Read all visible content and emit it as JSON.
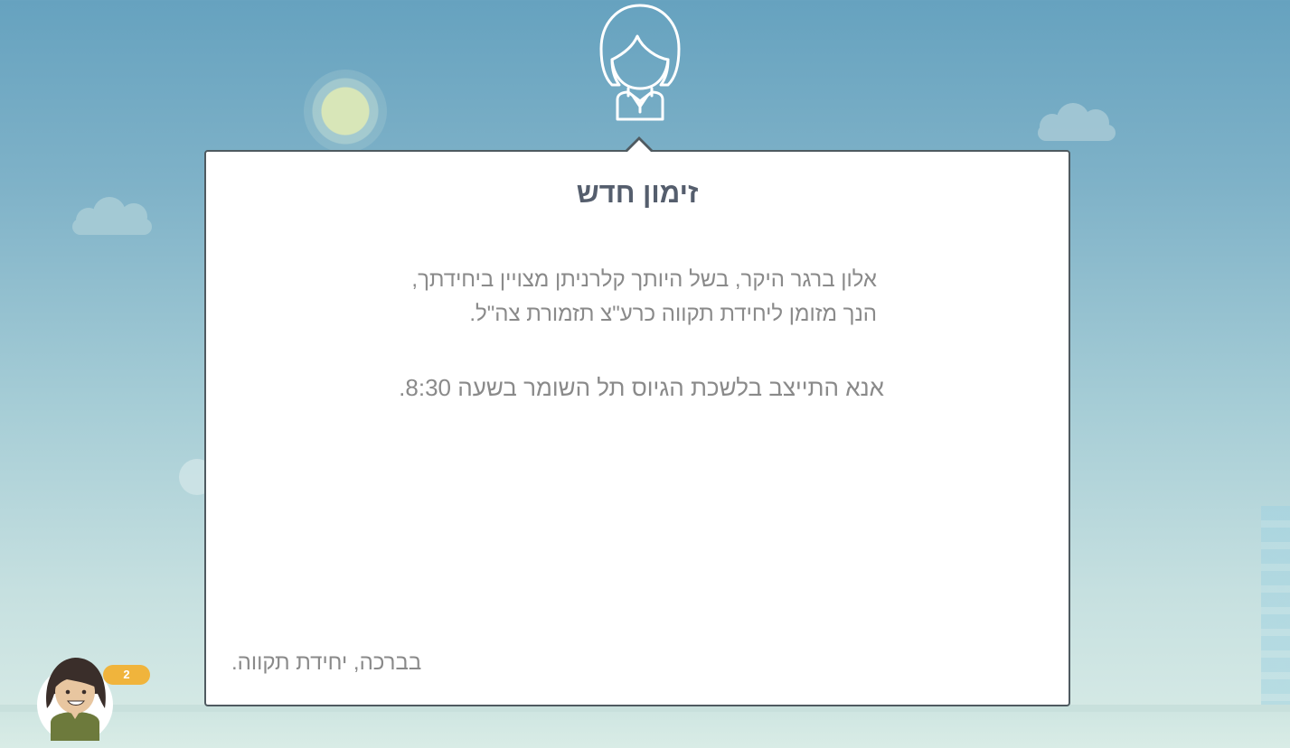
{
  "dialog": {
    "title": "זימון חדש",
    "line1": "אלון ברגר היקר, בשל היותך קלרניתן מצויין ביחידתך,",
    "line2": "הנך מזומן ליחידת תקווה כרע\"צ תזמורת צה\"ל.",
    "line3": "אנא התייצב בלשכת הגיוס תל השומר בשעה 8:30.",
    "signoff": "בברכה, יחידת תקווה."
  },
  "corner_avatar": {
    "badge_text": "2"
  },
  "colors": {
    "sky_top": "#66a2bf",
    "sky_bottom": "#d8ebe6",
    "dialog_border": "#4f5a60",
    "title": "#555e6d",
    "body_text": "#8a8a8a",
    "badge": "#f0b43c"
  },
  "icons": [
    "user-outline-icon",
    "sun-icon",
    "cloud-icon",
    "soldier-avatar-icon"
  ]
}
